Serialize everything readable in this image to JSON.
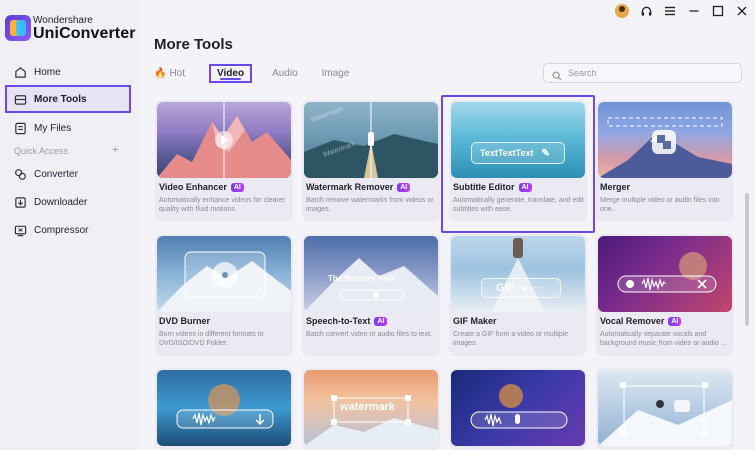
{
  "app": {
    "brand_top": "Wondershare",
    "brand_main": "UniConverter"
  },
  "sidebar": {
    "items": [
      {
        "label": "Home",
        "icon": "home-icon"
      },
      {
        "label": "More Tools",
        "icon": "toolbox-icon"
      },
      {
        "label": "My Files",
        "icon": "file-icon"
      },
      {
        "label": "Converter",
        "icon": "converter-icon"
      },
      {
        "label": "Downloader",
        "icon": "download-icon"
      },
      {
        "label": "Compressor",
        "icon": "compress-icon"
      }
    ],
    "quick_access": "Quick Access",
    "quick_add": "+"
  },
  "main": {
    "title": "More Tools",
    "tabs": [
      {
        "label": "Hot",
        "icon": "flame-icon"
      },
      {
        "label": "Video"
      },
      {
        "label": "Audio"
      },
      {
        "label": "Image"
      }
    ],
    "search_placeholder": "Search"
  },
  "cards": [
    {
      "name": "Video Enhancer",
      "ai": "AI",
      "desc": "Automatically enhance videos for clearer quality with fluid motions."
    },
    {
      "name": "Watermark Remover",
      "ai": "AI",
      "desc": "Batch remove watermarks from videos or images."
    },
    {
      "name": "Subtitle Editor",
      "ai": "AI",
      "desc": "Automatically generate, translate, and edit subtitles with ease.",
      "thumb_text": "TextTextText"
    },
    {
      "name": "Merger",
      "ai": "",
      "desc": "Merge multiple video or audio files into one."
    },
    {
      "name": "DVD Burner",
      "ai": "",
      "desc": "Burn videos in different formats to DVD/ISO/DVD Folder."
    },
    {
      "name": "Speech-to-Text",
      "ai": "AI",
      "desc": "Batch convert video or audio files to text.",
      "thumb_text": "The Scenery Here"
    },
    {
      "name": "GIF Maker",
      "ai": "",
      "desc": "Create a GIF from a video or multiple images.",
      "thumb_text": "GIF"
    },
    {
      "name": "Vocal Remover",
      "ai": "AI",
      "desc": "Automatically separate vocals and background music from video or audio ..."
    },
    {
      "name": "",
      "ai": "",
      "desc": ""
    },
    {
      "name": "",
      "ai": "",
      "desc": "",
      "thumb_text": "watermark"
    },
    {
      "name": "",
      "ai": "",
      "desc": ""
    },
    {
      "name": "",
      "ai": "",
      "desc": ""
    }
  ],
  "colors": {
    "accent": "#6b49e8",
    "ai_badge": "#8a3cf0",
    "sidebar_bg": "#f0eff6"
  }
}
